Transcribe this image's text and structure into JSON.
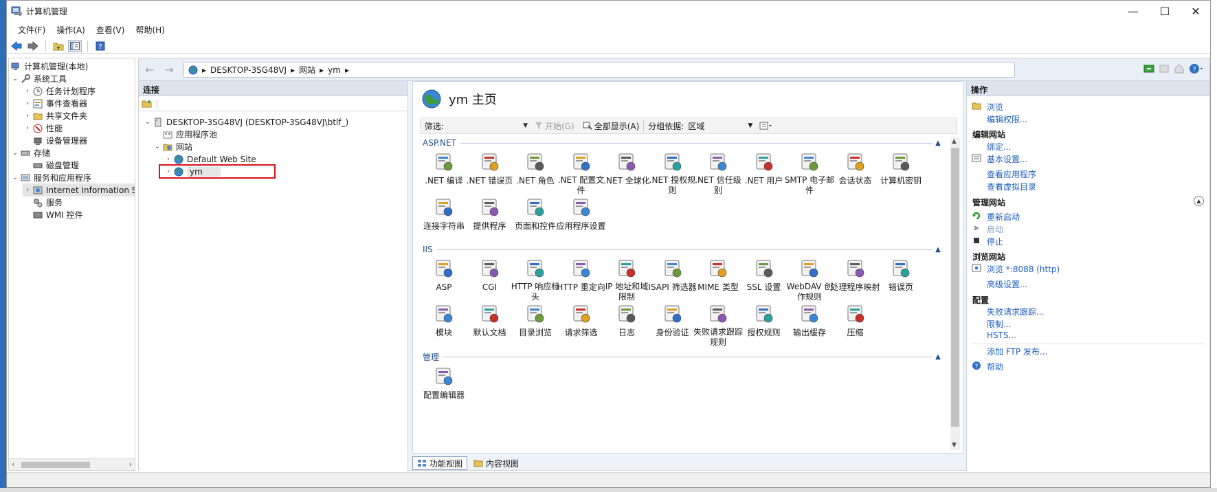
{
  "window": {
    "title": "计算机管理",
    "controls": {
      "minimize": "—",
      "maximize": "☐",
      "close": "✕"
    }
  },
  "menu": [
    "文件(F)",
    "操作(A)",
    "查看(V)",
    "帮助(H)"
  ],
  "tree": {
    "root": "计算机管理(本地)",
    "system_tools": "系统工具",
    "task_scheduler": "任务计划程序",
    "event_viewer": "事件查看器",
    "shared_folders": "共享文件夹",
    "performance": "性能",
    "device_manager": "设备管理器",
    "storage": "存储",
    "disk_management": "磁盘管理",
    "services_apps": "服务和应用程序",
    "iis": "Internet Information S",
    "services": "服务",
    "wmi": "WMI 控件"
  },
  "address": {
    "crumbs": [
      "DESKTOP-3SG48VJ",
      "网站",
      "ym"
    ],
    "sep": "▸"
  },
  "connections": {
    "title": "连接",
    "server": "DESKTOP-3SG48VJ (DESKTOP-3SG48VJ\\btlf_)",
    "app_pools": "应用程序池",
    "sites": "网站",
    "default_site": "Default Web Site",
    "ym": "ym"
  },
  "center": {
    "title": "ym 主页",
    "filter_label": "筛选:",
    "go_label": "开始(G)",
    "show_all_label": "全部显示(A)",
    "group_label": "分组依据:",
    "group_value": "区域"
  },
  "sections": {
    "aspnet": {
      "title": "ASP.NET",
      "items": [
        ".NET 编译",
        ".NET 错误页",
        ".NET 角色",
        ".NET 配置文件",
        ".NET 全球化",
        ".NET 授权规则",
        ".NET 信任级别",
        ".NET 用户",
        "SMTP 电子邮件",
        "会话状态",
        "计算机密钥",
        "连接字符串",
        "提供程序",
        "页面和控件",
        "应用程序设置"
      ]
    },
    "iis": {
      "title": "IIS",
      "items": [
        "ASP",
        "CGI",
        "HTTP 响应标头",
        "HTTP 重定向",
        "IP 地址和域限制",
        "ISAPI 筛选器",
        "MIME 类型",
        "SSL 设置",
        "WebDAV 创作规则",
        "处理程序映射",
        "错误页",
        "模块",
        "默认文档",
        "目录浏览",
        "请求筛选",
        "日志",
        "身份验证",
        "失败请求跟踪规则",
        "授权规则",
        "输出缓存",
        "压缩"
      ]
    },
    "mgmt": {
      "title": "管理",
      "items": [
        "配置编辑器"
      ]
    }
  },
  "view_tabs": {
    "features": "功能视图",
    "content": "内容视图"
  },
  "actions": {
    "title": "操作",
    "browse": "浏览",
    "edit_perms": "编辑权限...",
    "edit_site": "编辑网站",
    "bindings": "绑定...",
    "basic_settings": "基本设置...",
    "view_apps": "查看应用程序",
    "view_vdirs": "查看虚拟目录",
    "manage_site": "管理网站",
    "restart": "重新启动",
    "start": "启动",
    "stop": "停止",
    "browse_site": "浏览网站",
    "browse_8088": "浏览 *:8088 (http)",
    "advanced": "高级设置...",
    "config": "配置",
    "failed_trace": "失败请求跟踪...",
    "limits": "限制...",
    "hsts": "HSTS...",
    "add_ftp": "添加 FTP 发布...",
    "help": "帮助"
  },
  "colors": {
    "accent_link": "#1f5fbf",
    "highlight_box": "#e0101c",
    "section_title": "#1e4e8c"
  }
}
